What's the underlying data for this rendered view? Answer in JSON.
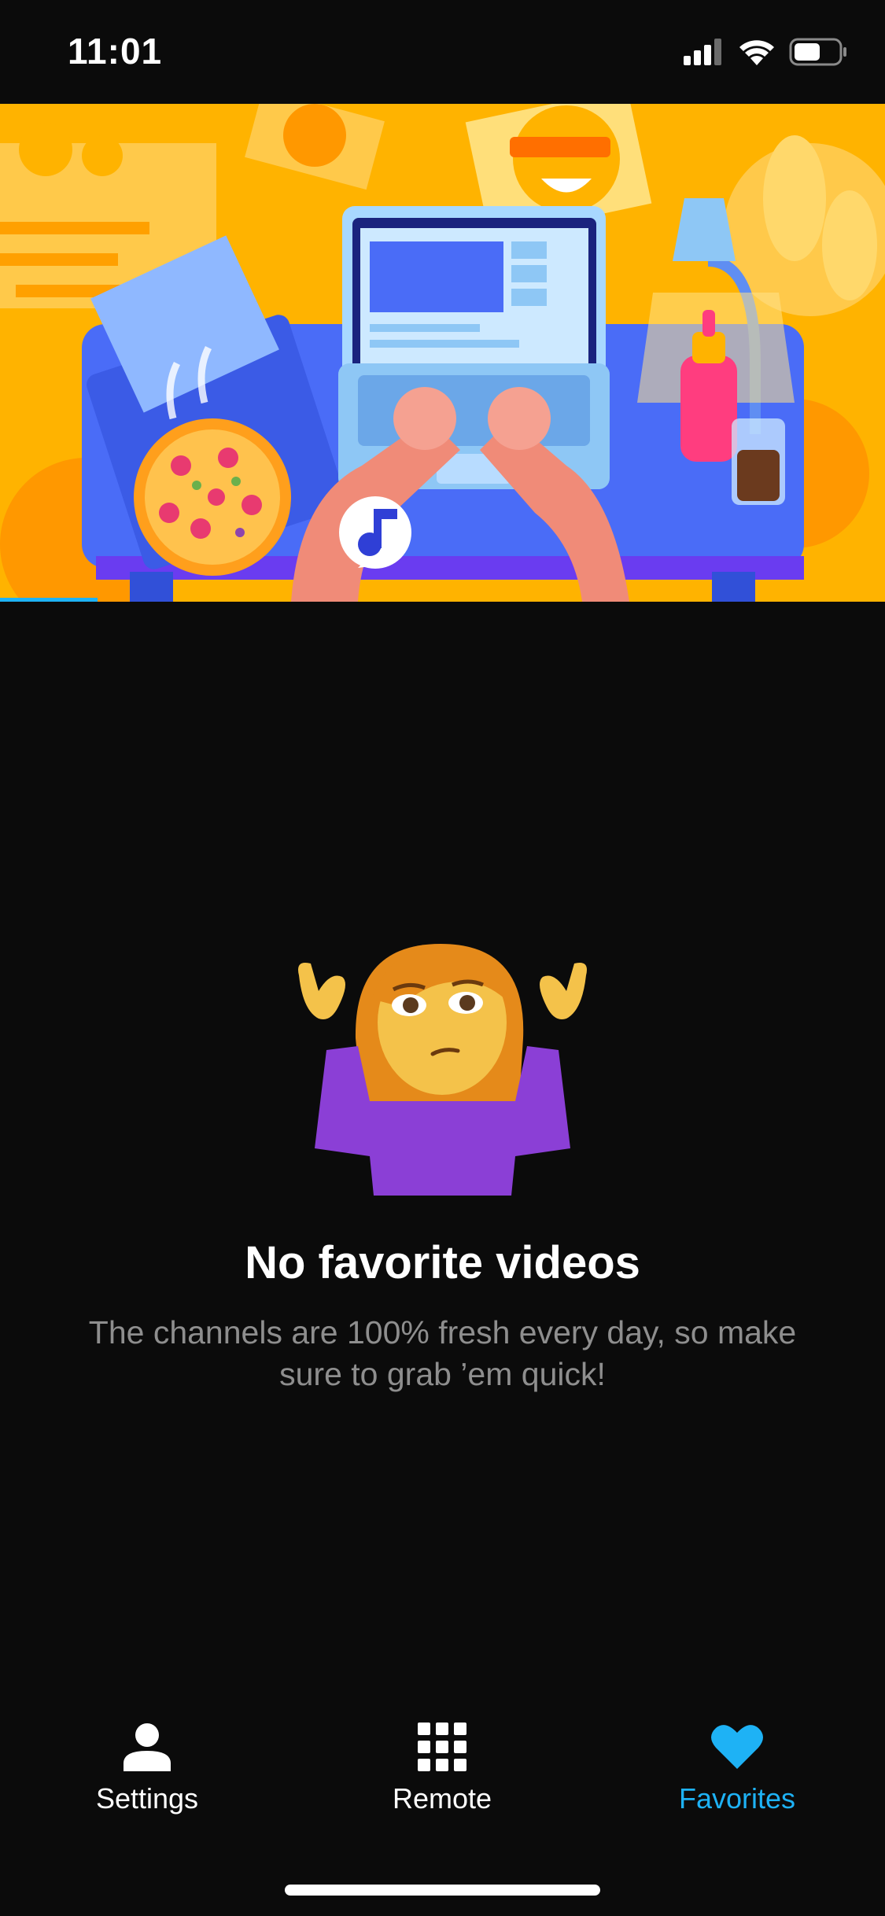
{
  "status_bar": {
    "time": "11:01",
    "icons": [
      "cellular-signal-icon",
      "wifi-icon",
      "battery-icon"
    ]
  },
  "hero": {
    "image": "video-hero-illustration",
    "playback_progress": 0.11
  },
  "empty_state": {
    "emoji": "person-shrugging-emoji",
    "title": "No favorite videos",
    "description": "The channels are 100% fresh every day, so make sure to grab ’em quick!"
  },
  "tabs": [
    {
      "label": "Settings",
      "icon": "person-icon",
      "active": false
    },
    {
      "label": "Remote",
      "icon": "grid-icon",
      "active": false
    },
    {
      "label": "Favorites",
      "icon": "heart-icon",
      "active": true
    }
  ],
  "colors": {
    "background": "#0b0b0b",
    "accent": "#1eb2f5",
    "secondary_text": "#8e8e8e",
    "hero_background": "#ffb300"
  }
}
